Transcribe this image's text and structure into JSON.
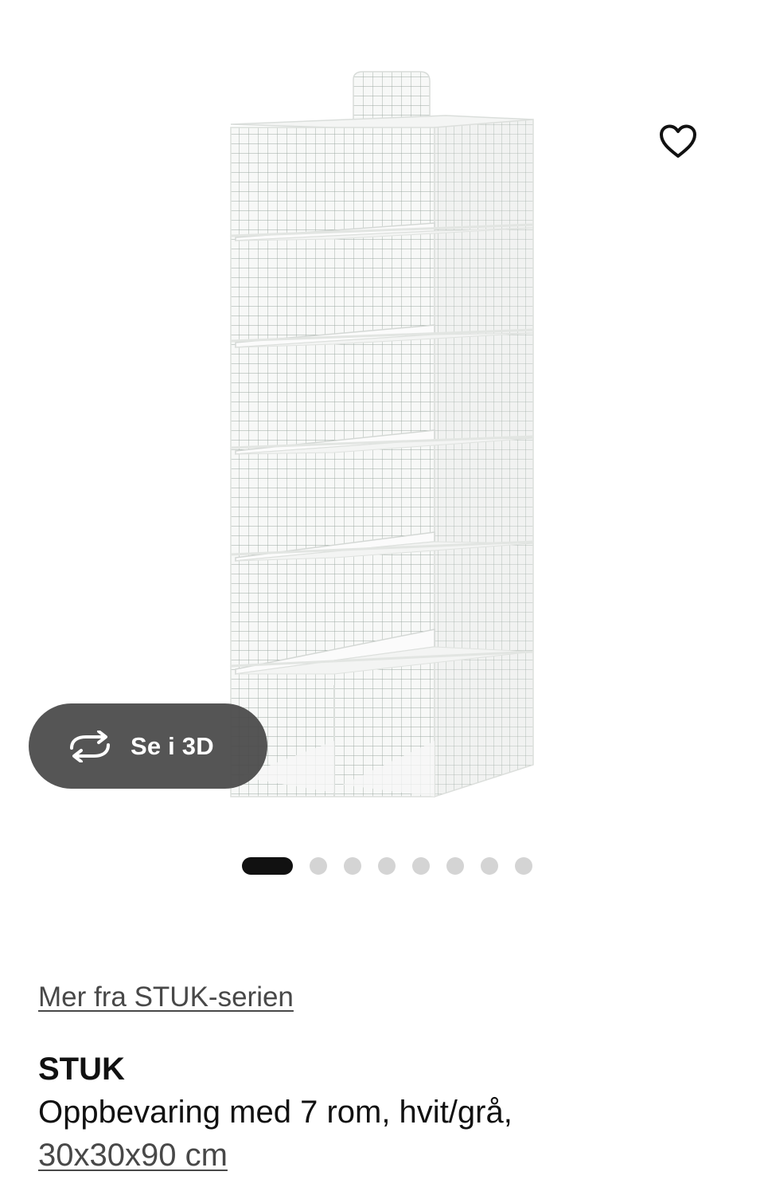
{
  "gallery": {
    "image_alt": "STUK storage organizer with 7 compartments, white/grey grid pattern",
    "favorite_icon": "heart-outline-icon",
    "view_3d": {
      "icon": "rotate-arrows-icon",
      "label": "Se i 3D"
    },
    "pagination": {
      "total": 8,
      "active_index": 0
    }
  },
  "product": {
    "series_link": "Mer fra STUK-serien",
    "name": "STUK",
    "description": "Oppbevaring med 7 rom, hvit/grå,",
    "size": "30x30x90 cm"
  },
  "colors": {
    "button_background": "#484848",
    "active_dot": "#111111",
    "inactive_dot": "#d4d4d4",
    "link_text": "#484848"
  }
}
